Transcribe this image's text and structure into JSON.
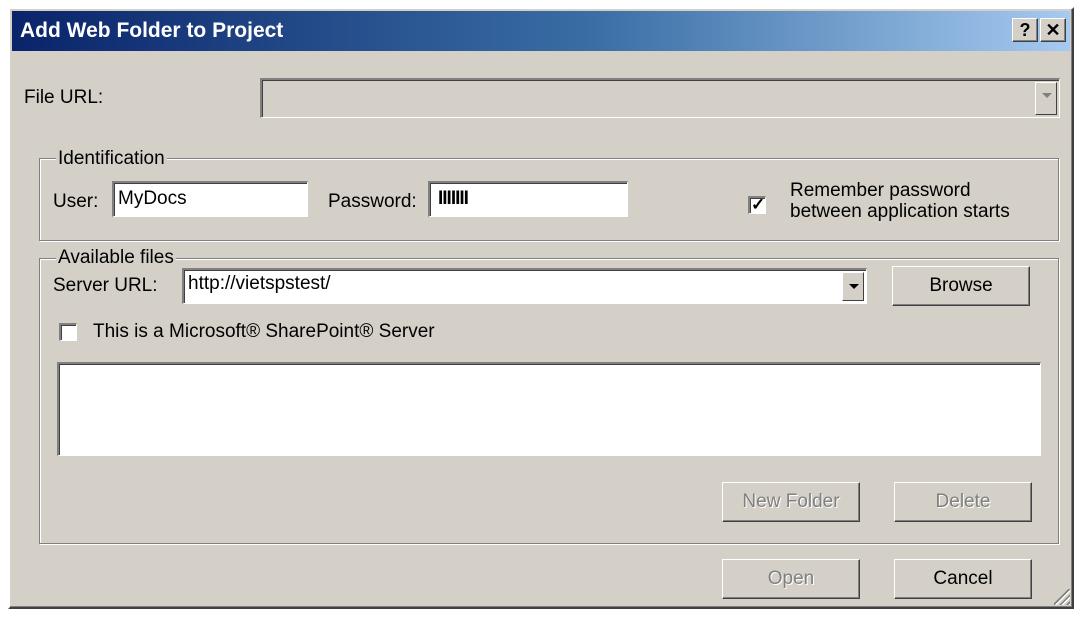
{
  "window": {
    "title": "Add Web Folder to Project",
    "help_button": "?",
    "close_button": "✕"
  },
  "file_url": {
    "label": "File URL:",
    "value": ""
  },
  "identification": {
    "legend": "Identification",
    "user_label": "User:",
    "user_value": "MyDocs",
    "password_label": "Password:",
    "password_value": "IIIIIII",
    "remember_label_line1": "Remember password",
    "remember_label_line2": "between application starts",
    "remember_checked": true
  },
  "available_files": {
    "legend": "Available files",
    "server_url_label": "Server URL:",
    "server_url_value": "http://vietspstest/",
    "browse_label": "Browse",
    "sharepoint_label": "This is a Microsoft® SharePoint® Server",
    "sharepoint_checked": false,
    "new_folder_label": "New Folder",
    "delete_label": "Delete"
  },
  "footer": {
    "open_label": "Open",
    "cancel_label": "Cancel"
  }
}
